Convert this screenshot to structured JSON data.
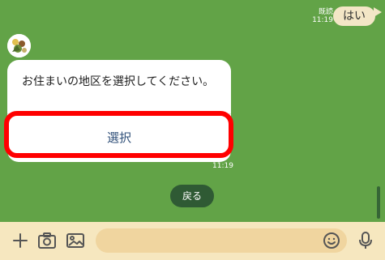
{
  "sent_message": {
    "read_label": "既読",
    "time": "11:19",
    "text": "はい"
  },
  "incoming_card": {
    "message": "お住まいの地区を選択してください。",
    "button_label": "選択",
    "time": "11:19"
  },
  "back_label": "戻る",
  "icons": [
    "plus-icon",
    "camera-icon",
    "image-icon",
    "emoji-icon",
    "microphone-icon"
  ],
  "colors": {
    "chat_background": "#62a347",
    "input_bar": "#f6e7bf",
    "highlight": "#ff0000"
  }
}
